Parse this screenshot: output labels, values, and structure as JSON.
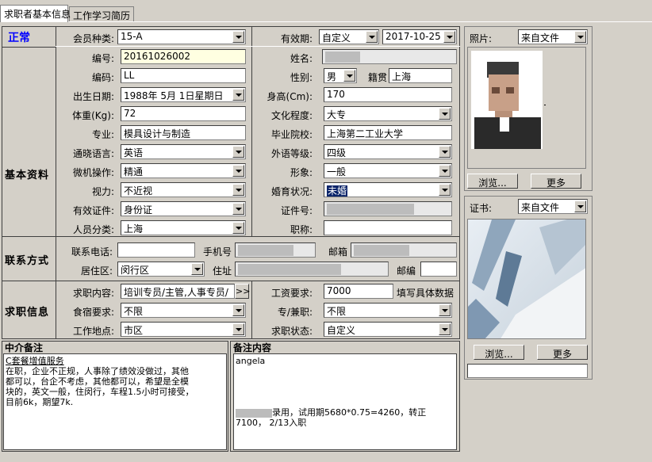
{
  "tabs": [
    {
      "label": "求职者基本信息",
      "active": true
    },
    {
      "label": "工作学习简历",
      "active": false
    }
  ],
  "status": "正常",
  "sections": {
    "basic": "基本资料",
    "contact": "联系方式",
    "job": "求职信息"
  },
  "fields": {
    "member_type": {
      "label": "会员种类:",
      "value": "15-A"
    },
    "validity": {
      "label": "有效期:",
      "mode": "自定义",
      "date": "2017-10-25"
    },
    "number": {
      "label": "编号:",
      "value": "20161026002"
    },
    "name": {
      "label": "姓名:"
    },
    "code": {
      "label": "编码:",
      "value": "LL"
    },
    "gender": {
      "label": "性别:",
      "value": "男"
    },
    "native_place": {
      "label": "籍贯",
      "value": "上海"
    },
    "birth": {
      "label": "出生日期:",
      "value": "1988年 5月 1日星期日"
    },
    "height": {
      "label": "身高(Cm):",
      "value": "170"
    },
    "weight": {
      "label": "体重(Kg):",
      "value": "72"
    },
    "education": {
      "label": "文化程度:",
      "value": "大专"
    },
    "major": {
      "label": "专业:",
      "value": "模具设计与制造"
    },
    "school": {
      "label": "毕业院校:",
      "value": "上海第二工业大学"
    },
    "language": {
      "label": "通晓语言:",
      "value": "英语"
    },
    "foreign_level": {
      "label": "外语等级:",
      "value": "四级"
    },
    "computer": {
      "label": "微机操作:",
      "value": "精通"
    },
    "appearance": {
      "label": "形象:",
      "value": "一般"
    },
    "eyesight": {
      "label": "视力:",
      "value": "不近视"
    },
    "marital": {
      "label": "婚育状况:",
      "value": "未婚"
    },
    "id_type": {
      "label": "有效证件:",
      "value": "身份证"
    },
    "id_number": {
      "label": "证件号:"
    },
    "person_type": {
      "label": "人员分类:",
      "value": "上海"
    },
    "title": {
      "label": "职称:"
    },
    "phone": {
      "label": "联系电话:"
    },
    "mobile": {
      "label": "手机号"
    },
    "email": {
      "label": "邮箱"
    },
    "district": {
      "label": "居住区:",
      "value": "闵行区"
    },
    "address": {
      "label": "住址"
    },
    "postcode": {
      "label": "邮编"
    },
    "job_content": {
      "label": "求职内容:",
      "value": "培训专员/主管,人事专员/",
      "more": ">>"
    },
    "salary": {
      "label": "工资要求:",
      "value": "7000",
      "hint": "填写具体数据"
    },
    "board": {
      "label": "食宿要求:",
      "value": "不限"
    },
    "parttime": {
      "label": "专/兼职:",
      "value": "不限"
    },
    "location": {
      "label": "工作地点:",
      "value": "市区"
    },
    "job_status": {
      "label": "求职状态:",
      "value": "自定义"
    }
  },
  "agency_notes": {
    "title": "中介备注",
    "lines": [
      "C套餐增值服务",
      "在职，企业不正规，人事除了绩效没做过，其他",
      "都可以，台企不考虑，其他都可以，希望是全模",
      "块的，英文一般，住闵行，车程1.5小时可接受，",
      "目前6k，期望7k."
    ]
  },
  "remarks": {
    "title": "备注内容",
    "top": "angela",
    "line1": "录用，试用期5680*0.75=4260，转正",
    "line2": "7100， 2/13入职"
  },
  "photo_panel": {
    "label": "照片:",
    "source": "来自文件",
    "browse": "浏览...",
    "more": "更多"
  },
  "cert_panel": {
    "label": "证书:",
    "source": "来自文件",
    "browse": "浏览...",
    "more": "更多"
  }
}
